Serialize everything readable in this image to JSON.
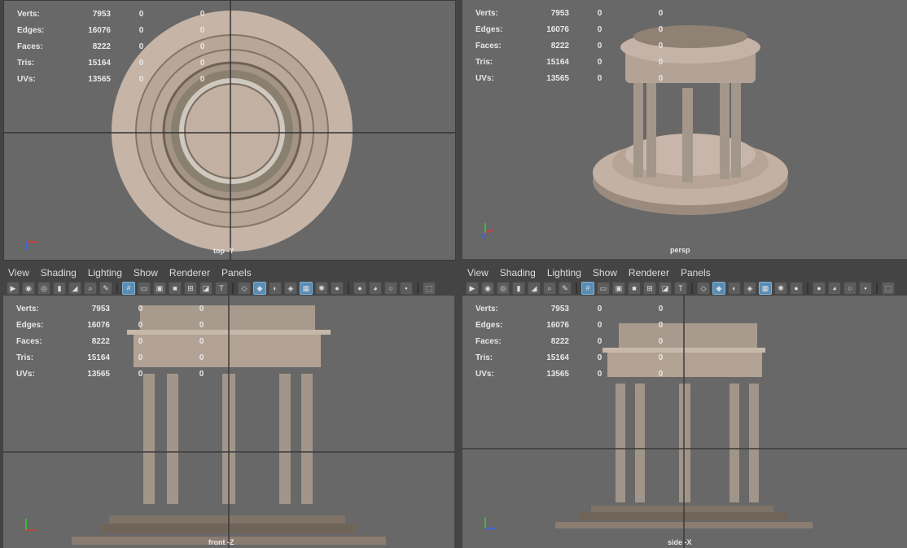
{
  "hud_labels": {
    "verts": "Verts:",
    "edges": "Edges:",
    "faces": "Faces:",
    "tris": "Tris:",
    "uvs": "UVs:"
  },
  "hud_values": {
    "verts": "7953",
    "edges": "16076",
    "faces": "8222",
    "tris": "15164",
    "uvs": "13565"
  },
  "zero": "0",
  "cameras": {
    "top": "top -Y",
    "persp": "persp",
    "front": "front -Z",
    "side": "side -X"
  },
  "menu": {
    "view": "View",
    "shading": "Shading",
    "lighting": "Lighting",
    "show": "Show",
    "renderer": "Renderer",
    "panels": "Panels"
  },
  "axis": {
    "x": "x",
    "y": "y",
    "z": "z"
  },
  "colors": {
    "viewport_bg": "#686868",
    "grid": "#3a3a3a",
    "stone": "#b8a898",
    "accent": "#5a8db4"
  }
}
